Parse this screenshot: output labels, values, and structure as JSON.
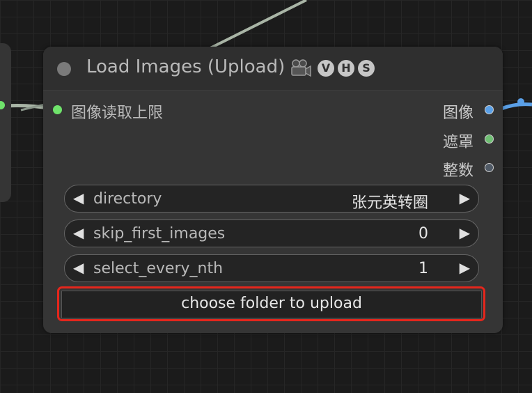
{
  "node": {
    "title": "Load Images (Upload)",
    "badges": [
      "V",
      "H",
      "S"
    ],
    "input": {
      "label": "图像读取上限"
    },
    "outputs": [
      {
        "label": "图像",
        "color": "#5aa0e8"
      },
      {
        "label": "遮罩",
        "color": "#6fbf73"
      },
      {
        "label": "整数",
        "color": "#505a66"
      }
    ],
    "widgets": [
      {
        "name": "directory",
        "value": "张元英转圈"
      },
      {
        "name": "skip_first_images",
        "value": "0"
      },
      {
        "name": "select_every_nth",
        "value": "1"
      }
    ],
    "upload_button": "choose folder to upload"
  },
  "icons": {
    "collapse": "collapse-dot-icon",
    "camera": "movie-camera-icon",
    "arrow_left": "◀",
    "arrow_right": "▶"
  },
  "colors": {
    "highlight": "#e5261c",
    "input_slot": "#6fe36b",
    "wire": "#a9b5a6"
  }
}
